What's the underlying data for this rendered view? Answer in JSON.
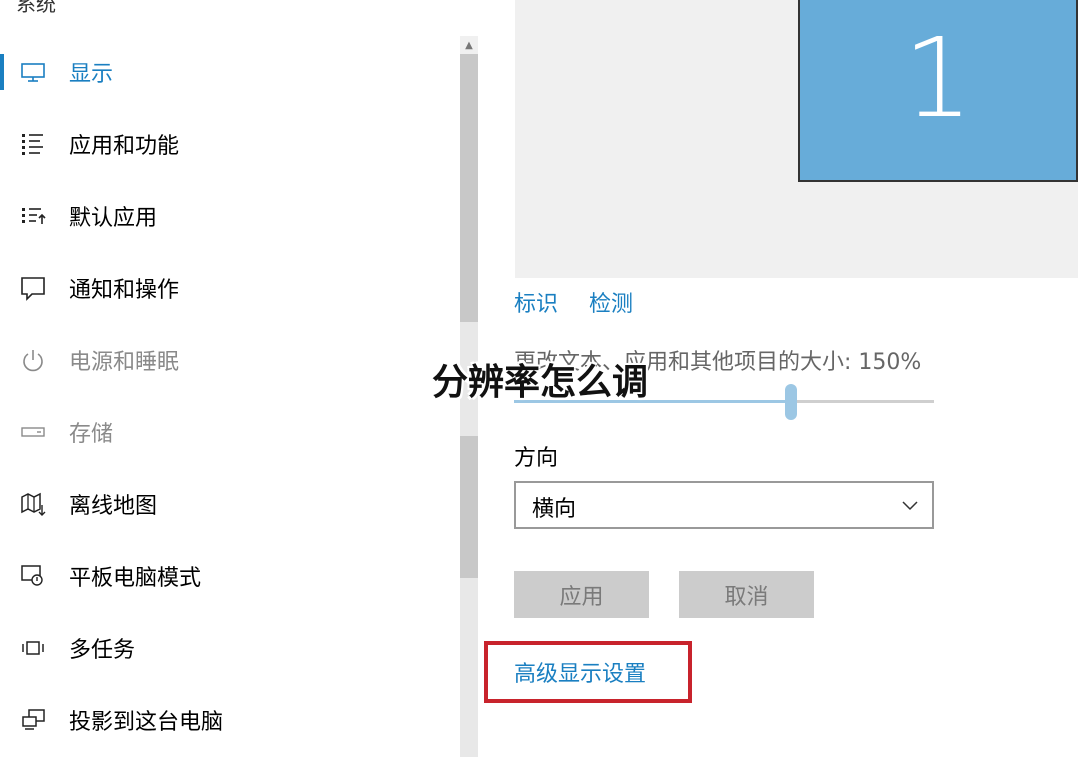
{
  "sidebar": {
    "section_title": "系统",
    "items": [
      {
        "label": "显示",
        "icon": "monitor-icon",
        "state": "active"
      },
      {
        "label": "应用和功能",
        "icon": "apps-list-icon",
        "state": "normal"
      },
      {
        "label": "默认应用",
        "icon": "default-apps-icon",
        "state": "normal"
      },
      {
        "label": "通知和操作",
        "icon": "notification-icon",
        "state": "normal"
      },
      {
        "label": "电源和睡眠",
        "icon": "power-icon",
        "state": "disabled"
      },
      {
        "label": "存储",
        "icon": "storage-icon",
        "state": "disabled"
      },
      {
        "label": "离线地图",
        "icon": "map-icon",
        "state": "normal"
      },
      {
        "label": "平板电脑模式",
        "icon": "tablet-mode-icon",
        "state": "normal"
      },
      {
        "label": "多任务",
        "icon": "multitask-icon",
        "state": "normal"
      },
      {
        "label": "投影到这台电脑",
        "icon": "project-icon",
        "state": "normal"
      }
    ]
  },
  "display": {
    "monitor_number": "1",
    "identify_link": "标识",
    "detect_link": "检测",
    "scale_label": "更改文本、应用和其他项目的大小: 150%",
    "scale_slider_fraction": 0.66,
    "orientation_label": "方向",
    "orientation_value": "横向",
    "apply_button": "应用",
    "cancel_button": "取消",
    "advanced_link": "高级显示设置"
  },
  "overlay": {
    "title": "分辨率怎么调"
  },
  "colors": {
    "accent": "#1a7fc1",
    "monitor": "#67acd9",
    "highlight": "#c8232c"
  }
}
